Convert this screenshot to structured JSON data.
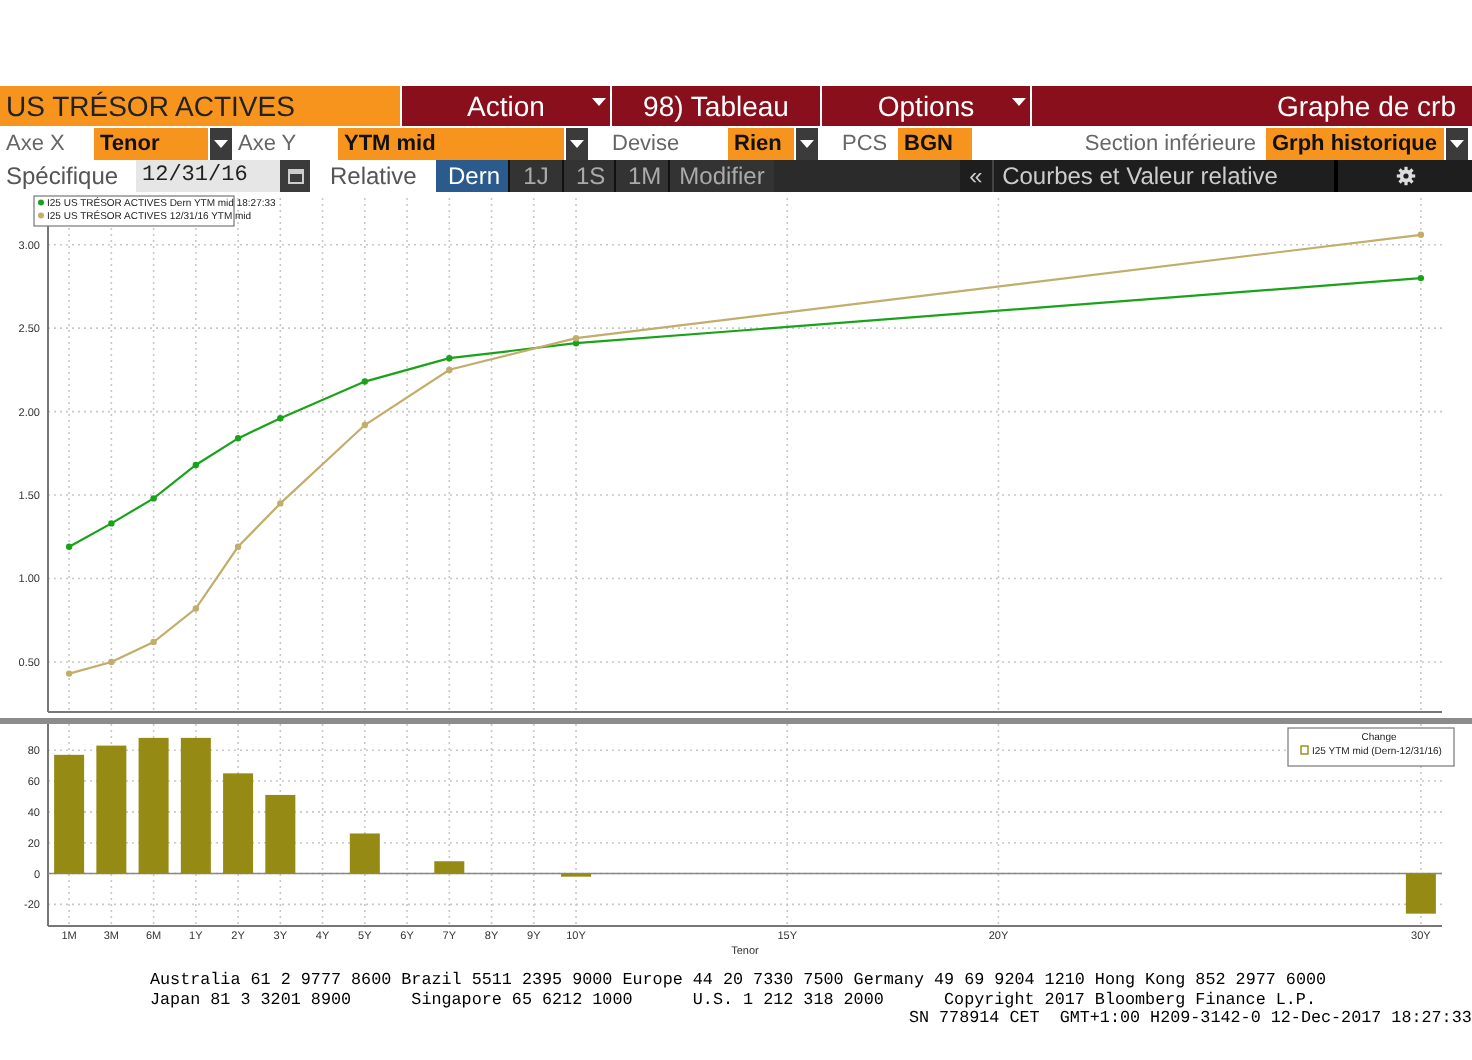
{
  "toolbar": {
    "title": "US TRÉSOR ACTIVES",
    "menus": [
      {
        "label": "Action",
        "kind": "dropdown"
      },
      {
        "label": "98) Tableau",
        "kind": "button"
      },
      {
        "label": "Options",
        "kind": "dropdown"
      }
    ],
    "chart_name": "Graphe de crb"
  },
  "settings": [
    {
      "label": "Axe X",
      "value": "Tenor",
      "kind": "dropdown"
    },
    {
      "label": "Axe Y",
      "value": "YTM mid",
      "kind": "dropdown"
    },
    {
      "label": "Devise",
      "value": "Rien",
      "kind": "dropdown"
    },
    {
      "label": "PCS",
      "value": "BGN",
      "kind": "field"
    },
    {
      "label": "Section inférieure",
      "value": "Grph historique",
      "kind": "dropdown"
    }
  ],
  "relative": {
    "date_label": "Spécifique",
    "date": "12/31/16",
    "label": "Relative",
    "periods": [
      {
        "label": "Dern",
        "selected": true
      },
      {
        "label": "1J",
        "selected": false
      },
      {
        "label": "1S",
        "selected": false
      },
      {
        "label": "1M",
        "selected": false
      }
    ],
    "modify_button": "Modifier",
    "collapse_button": "«",
    "view_button": "Courbes et Valeur relative"
  },
  "yield_chart": {
    "chart_data": {
      "type": "line",
      "categories": [
        null,
        null,
        null,
        null,
        null,
        null,
        null,
        null,
        null,
        null,
        null,
        null,
        null,
        null,
        null,
        null,
        null,
        null,
        null,
        null,
        null,
        null,
        null,
        null,
        null,
        null,
        null,
        null,
        null,
        null,
        null,
        null,
        null
      ],
      "ylim": [
        0.2,
        3.28
      ],
      "grid": true,
      "legend": "upper left",
      "yticks": [
        {
          "value": 0.5,
          "label": "0.50"
        },
        {
          "value": 1,
          "label": "1.00"
        },
        {
          "value": 1.5,
          "label": "1.50"
        },
        {
          "value": 2,
          "label": "2.00"
        },
        {
          "value": 2.5,
          "label": "2.50"
        },
        {
          "value": 3,
          "label": "3.00"
        }
      ],
      "series": [
        {
          "name": "I25 US TRÉSOR ACTIVES Dern YTM mid 18:27:33",
          "color": "#1aa31a",
          "marker": "o",
          "values": [
            1.19,
            1.33,
            1.48,
            1.68,
            1.84,
            1.96,
            null,
            2.18,
            null,
            2.32,
            null,
            null,
            2.41,
            null,
            null,
            null,
            null,
            null,
            null,
            null,
            null,
            null,
            null,
            null,
            null,
            null,
            null,
            null,
            null,
            null,
            null,
            null,
            2.8
          ]
        },
        {
          "name": "I25 US TRÉSOR ACTIVES 12/31/16 YTM mid",
          "color": "#c2ad6a",
          "marker": "o",
          "values": [
            0.43,
            0.5,
            0.62,
            0.82,
            1.19,
            1.45,
            null,
            1.92,
            null,
            2.25,
            null,
            null,
            2.44,
            null,
            null,
            null,
            null,
            null,
            null,
            null,
            null,
            null,
            null,
            null,
            null,
            null,
            null,
            null,
            null,
            null,
            null,
            null,
            3.06
          ]
        }
      ]
    }
  },
  "change_chart": {
    "legend_title": "Change",
    "chart_data": {
      "type": "bar",
      "xlabel": "Tenor",
      "grid": true,
      "legend": "upper right",
      "categories": [
        "1M",
        "3M",
        "6M",
        "1Y",
        "2Y",
        "3Y",
        "4Y",
        "5Y",
        "6Y",
        "7Y",
        "8Y",
        "9Y",
        "10Y",
        null,
        null,
        null,
        null,
        "15Y",
        null,
        null,
        null,
        null,
        "20Y",
        null,
        null,
        null,
        null,
        null,
        null,
        null,
        null,
        null,
        "30Y"
      ],
      "ylim": [
        -34,
        97
      ],
      "yticks": [
        {
          "value": -20,
          "label": "-20"
        },
        {
          "value": 0,
          "label": "0"
        },
        {
          "value": 20,
          "label": "20"
        },
        {
          "value": 40,
          "label": "40"
        },
        {
          "value": 60,
          "label": "60"
        },
        {
          "value": 80,
          "label": "80"
        }
      ],
      "series": [
        {
          "name": "I25 YTM mid (Dern-12/31/16)",
          "color": "#948a14",
          "values": [
            77,
            83,
            88,
            88,
            65,
            51,
            null,
            26,
            null,
            8,
            null,
            null,
            -2,
            null,
            null,
            null,
            null,
            null,
            null,
            null,
            null,
            null,
            null,
            null,
            null,
            null,
            null,
            null,
            null,
            null,
            null,
            null,
            -26
          ]
        }
      ]
    }
  },
  "footer": [
    [
      "Australia 61 2 9777 8600 Brazil 5511 2395 9000 Europe 44 20 7330 7500 Germany 49 69 9204 1210 Hong Kong 852 2977 6000"
    ],
    [
      "Japan 81 3 3201 8900",
      "Singapore 65 6212 1000",
      "U.S. 1 212 318 2000",
      "Copyright 2017 Bloomberg Finance L.P."
    ],
    [
      "SN 778914 CET  GMT+1:00 H209-3142-0 12-Dec-2017 18:27:33"
    ]
  ]
}
